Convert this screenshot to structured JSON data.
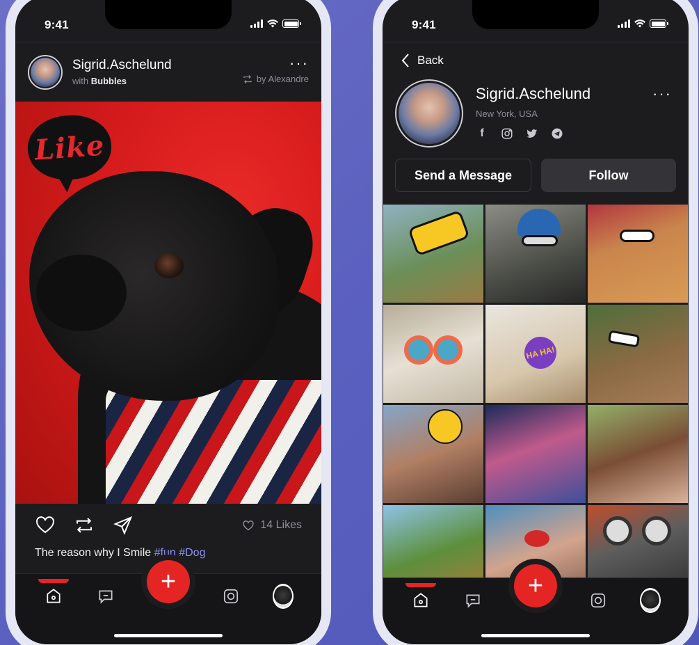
{
  "status": {
    "time": "9:41"
  },
  "feed": {
    "user": "Sigrid.Aschelund",
    "with_prefix": "with",
    "with_name": "Bubbles",
    "repost_by": "by Alexandre",
    "sticker_text": "Like",
    "likes": "14 Likes",
    "caption_text": "The reason why I Smile",
    "caption_tags": "#fun #Dog"
  },
  "profile": {
    "back_label": "Back",
    "name": "Sigrid.Aschelund",
    "location": "New York, USA",
    "send_message": "Send a Message",
    "follow": "Follow",
    "socials": [
      "facebook-icon",
      "instagram-icon",
      "twitter-icon",
      "telegram-icon"
    ],
    "gallery": [
      "giraffe-with-sunglasses",
      "gorilla-with-helmet",
      "dog-with-sunglasses",
      "sheep-with-glasses",
      "llama-ha-ha-sticker",
      "monkey-with-glasses",
      "boys-with-emoji",
      "girl-eating",
      "cow-tongue",
      "giraffe-leaves",
      "man-with-lips",
      "owl-goggles"
    ],
    "ha_sticker": "HA HA!"
  },
  "tabs": [
    "home-icon",
    "chat-icon",
    "add-icon",
    "instagram-icon",
    "profile-avatar"
  ],
  "colors": {
    "accent": "#e42524",
    "bg": "#1c1c1f",
    "tag": "#8a8ff0"
  }
}
